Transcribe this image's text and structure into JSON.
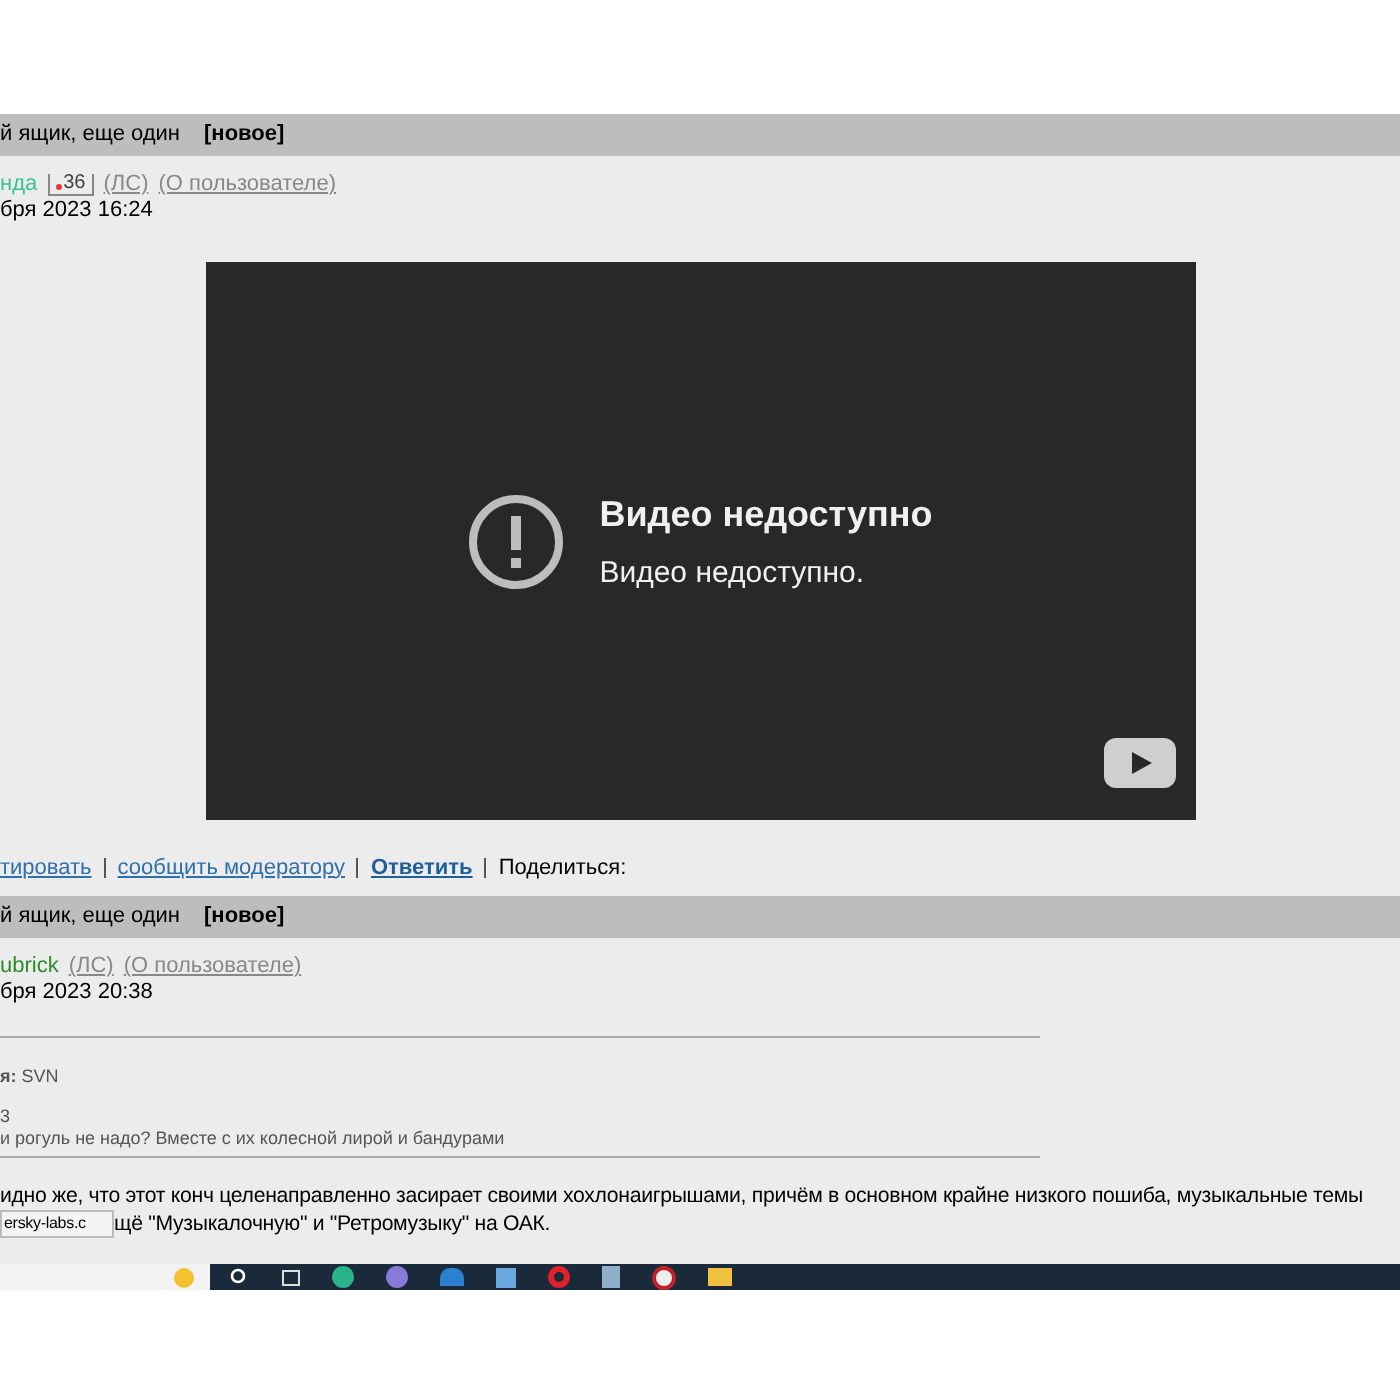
{
  "posts": [
    {
      "title": "й ящик, еще один",
      "badge": "[новое]",
      "author": "нда",
      "color": "#3cc48f",
      "rating": "36",
      "pm": "(ЛС)",
      "profile": "(О пользователе)",
      "date": "бря 2023 16:24",
      "video": {
        "kind": "unavailable",
        "heading": "Видео недоступно",
        "message": "Видео недоступно."
      },
      "actions": [
        {
          "label": "тировать",
          "bold": false
        },
        {
          "label": "сообщить модератору",
          "bold": false
        },
        {
          "label": "Ответить",
          "bold": true
        }
      ],
      "share": "Поделиться:"
    },
    {
      "title": "й ящик, еще один",
      "badge": "[новое]",
      "author": "ubrick",
      "color": "#2e8b2e",
      "pm": "(ЛС)",
      "profile": "(О пользователе)",
      "date": "бря 2023 20:38",
      "quote": {
        "source": "**я:** SVN",
        "date": "3",
        "text": "и рогуль не надо? Вместе с их колесной лирой и бандурами"
      },
      "body": [
        "идно же, что этот конч целенаправленно засирает своими хохлонаигрышами, причём в основном крайне низкого пошиба, музыкальные темы",
        "щё \"Музыкалочную\" и \"Ретромузыку\" на ОАК."
      ]
    }
  ],
  "tooltip": "ersky-labs.c"
}
